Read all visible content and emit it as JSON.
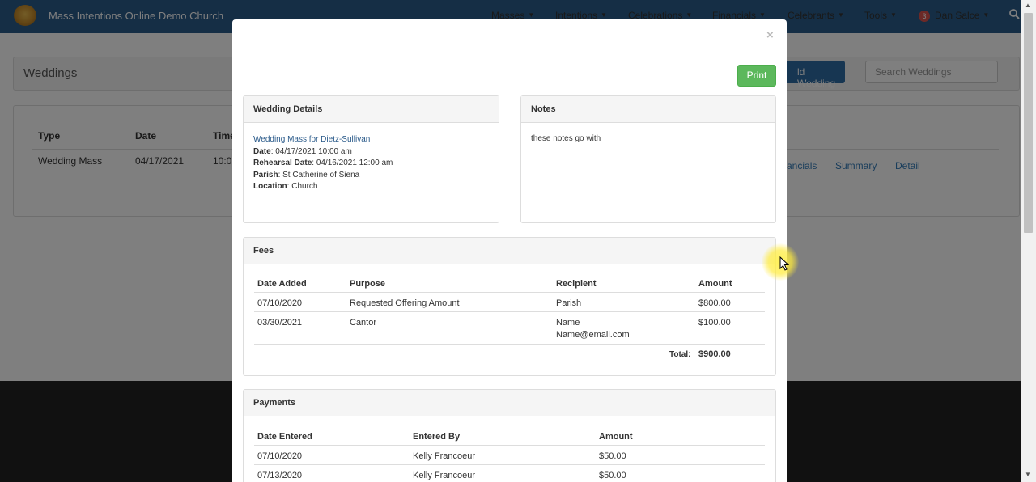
{
  "navbar": {
    "brand": "Mass Intentions Online Demo Church",
    "menu": [
      {
        "label": "Masses"
      },
      {
        "label": "Intentions"
      },
      {
        "label": "Celebrations"
      },
      {
        "label": "Financials"
      },
      {
        "label": "Celebrants"
      },
      {
        "label": "Tools"
      }
    ],
    "notification_count": "3",
    "user": "Dan Salce"
  },
  "background_page": {
    "title": "Weddings",
    "add_button": "ld Wedding",
    "search_placeholder": "Search Weddings",
    "columns": [
      "Type",
      "Date",
      "Time"
    ],
    "row": {
      "type": "Wedding Mass",
      "date": "04/17/2021",
      "time": "10:0"
    },
    "row_links": [
      "ancials",
      "Summary",
      "Detail"
    ]
  },
  "modal": {
    "close_glyph": "×",
    "print_label": "Print",
    "wedding_details": {
      "heading": "Wedding Details",
      "mass_title": "Wedding Mass for Dietz-Sullivan",
      "date_label": "Date",
      "date_value": "04/17/2021 10:00 am",
      "rehearsal_label": "Rehearsal Date",
      "rehearsal_value": "04/16/2021 12:00 am",
      "parish_label": "Parish",
      "parish_value": "St Catherine of Siena",
      "location_label": "Location",
      "location_value": "Church"
    },
    "notes": {
      "heading": "Notes",
      "text": "these notes go with"
    },
    "fees": {
      "heading": "Fees",
      "columns": [
        "Date Added",
        "Purpose",
        "Recipient",
        "Amount"
      ],
      "rows": [
        {
          "date": "07/10/2020",
          "purpose": "Requested Offering Amount",
          "recipient": "Parish",
          "recipient2": "",
          "amount": "$800.00"
        },
        {
          "date": "03/30/2021",
          "purpose": "Cantor",
          "recipient": "Name",
          "recipient2": "Name@email.com",
          "amount": "$100.00"
        }
      ],
      "total_label": "Total:",
      "total_value": "$900.00"
    },
    "payments": {
      "heading": "Payments",
      "columns": [
        "Date Entered",
        "Entered By",
        "Amount"
      ],
      "rows": [
        {
          "date": "07/10/2020",
          "by": "Kelly Francoeur",
          "amount": "$50.00"
        },
        {
          "date": "07/13/2020",
          "by": "Kelly Francoeur",
          "amount": "$50.00"
        }
      ]
    }
  },
  "colors": {
    "navbar": "#2b5c8a",
    "print_button": "#5cb85c",
    "link": "#337ab7"
  }
}
